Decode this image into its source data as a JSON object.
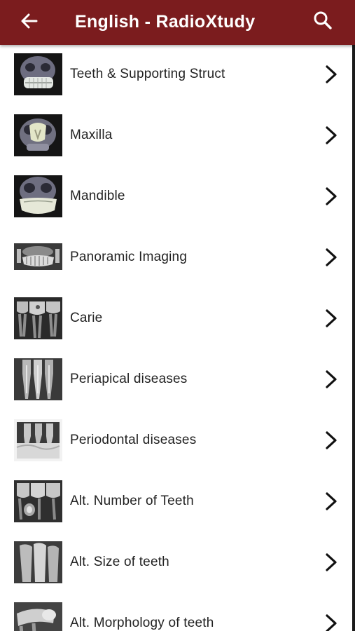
{
  "header": {
    "title": "English - RadioXtudy",
    "back_icon": "arrow-left-icon",
    "search_icon": "search-icon",
    "background_color": "#7b1c1e",
    "text_color": "#ffffff"
  },
  "items": [
    {
      "label": "Teeth & Supporting Struct",
      "thumbnail": "skull-3d-teeth"
    },
    {
      "label": "Maxilla",
      "thumbnail": "skull-3d-maxilla"
    },
    {
      "label": "Mandible",
      "thumbnail": "skull-3d-mandible"
    },
    {
      "label": "Panoramic Imaging",
      "thumbnail": "panoramic-xray"
    },
    {
      "label": "Carie",
      "thumbnail": "bitewing-xray"
    },
    {
      "label": "Periapical diseases",
      "thumbnail": "periapical-xray"
    },
    {
      "label": "Periodontal diseases",
      "thumbnail": "periodontal-xray"
    },
    {
      "label": "Alt. Number of Teeth",
      "thumbnail": "molar-xray"
    },
    {
      "label": "Alt. Size of teeth",
      "thumbnail": "incisor-xray"
    },
    {
      "label": "Alt. Morphology of teeth",
      "thumbnail": "morphology-xray"
    }
  ]
}
